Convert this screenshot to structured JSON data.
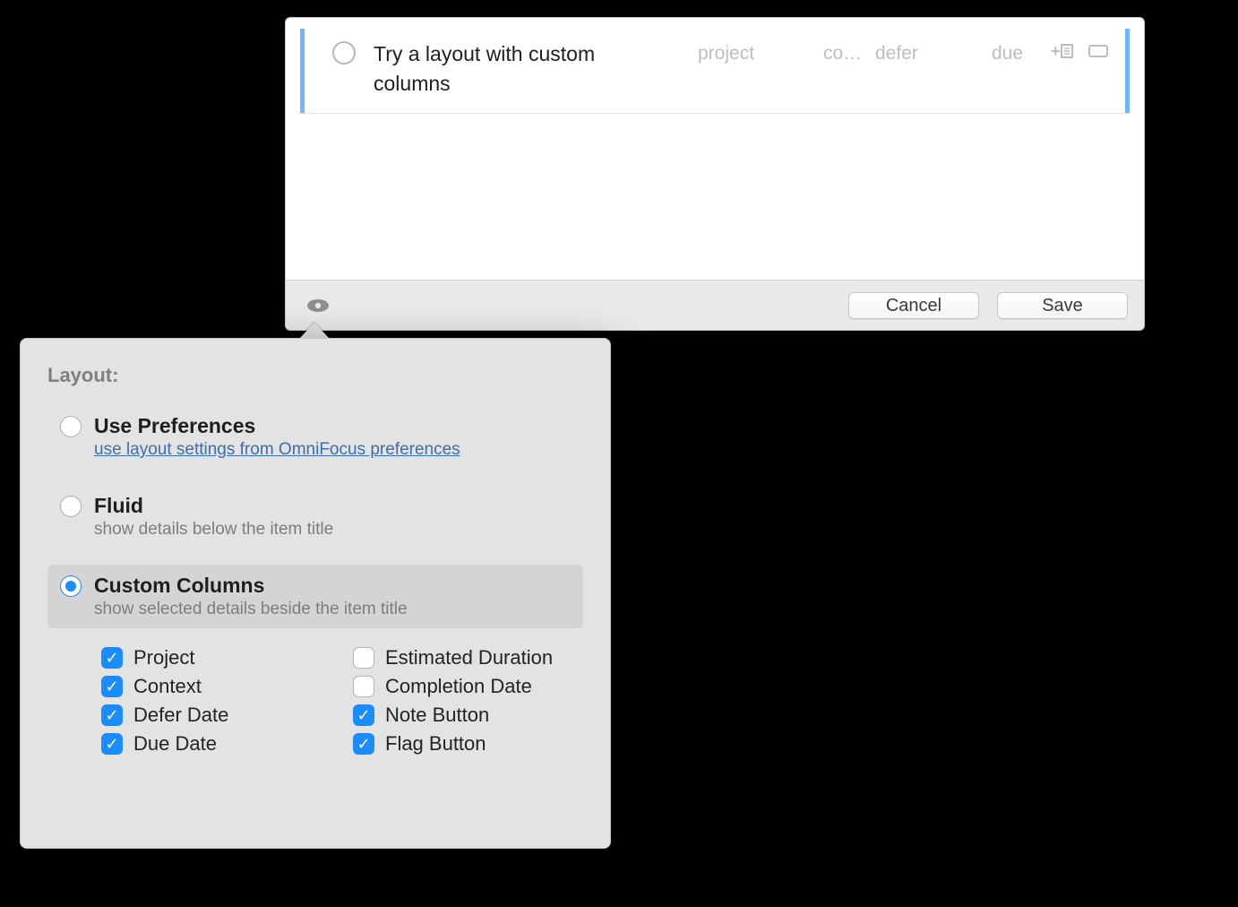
{
  "task": {
    "title": "Try a layout with custom columns",
    "columns": {
      "project": "project",
      "context": "co…",
      "defer": "defer",
      "due": "due"
    }
  },
  "footer": {
    "cancel_label": "Cancel",
    "save_label": "Save"
  },
  "popover": {
    "section_label": "Layout:",
    "options": [
      {
        "id": "use_prefs",
        "title": "Use Preferences",
        "link": "use layout settings from OmniFocus preferences",
        "selected": false
      },
      {
        "id": "fluid",
        "title": "Fluid",
        "desc": "show details below the item title",
        "selected": false
      },
      {
        "id": "custom_columns",
        "title": "Custom Columns",
        "desc": "show selected details beside the item title",
        "selected": true
      }
    ],
    "columns_left": [
      {
        "label": "Project",
        "checked": true
      },
      {
        "label": "Context",
        "checked": true
      },
      {
        "label": "Defer Date",
        "checked": true
      },
      {
        "label": "Due Date",
        "checked": true
      }
    ],
    "columns_right": [
      {
        "label": "Estimated Duration",
        "checked": false
      },
      {
        "label": "Completion Date",
        "checked": false
      },
      {
        "label": "Note Button",
        "checked": true
      },
      {
        "label": "Flag Button",
        "checked": true
      }
    ]
  }
}
